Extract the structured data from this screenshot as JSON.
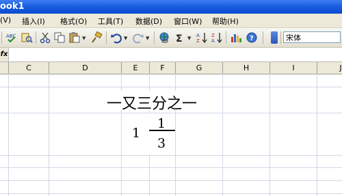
{
  "window": {
    "title": "ook1"
  },
  "menu": {
    "items": [
      "(V)",
      "插入(I)",
      "格式(O)",
      "工具(T)",
      "数据(D)",
      "窗口(W)",
      "帮助(H)"
    ]
  },
  "toolbar": {
    "font_name": "宋体",
    "icons": [
      "spelling-icon",
      "research-icon",
      "cut-icon",
      "copy-icon",
      "paste-icon",
      "format-painter-icon",
      "undo-icon",
      "redo-icon",
      "hyperlink-icon",
      "autosum-icon",
      "sort-ascending-icon",
      "sort-descending-icon",
      "chart-wizard-icon",
      "help-icon"
    ]
  },
  "formula_bar": {
    "fx_label": "fx"
  },
  "columns": [
    "C",
    "D",
    "E",
    "F",
    "G",
    "H",
    "I",
    "J"
  ],
  "cells": {
    "heading": "一又三分之一",
    "whole": "1",
    "numerator": "1",
    "denominator": "3"
  },
  "colors": {
    "titlebar": "#0b4ad0",
    "gridline": "#d0d7e5",
    "header_bg": "#ece9d8"
  }
}
